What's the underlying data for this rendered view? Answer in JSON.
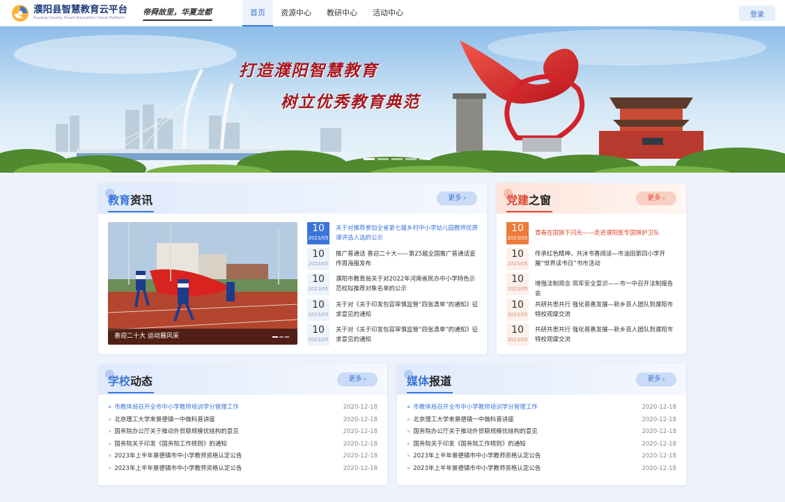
{
  "header": {
    "title": "濮阳县智慧教育云平台",
    "subtitle": "Puyang County Smart Education Cloud Platform",
    "slogan": "帝舜故里，华夏龙都",
    "nav": [
      "首页",
      "资源中心",
      "教研中心",
      "活动中心"
    ],
    "login": "登录"
  },
  "banner": {
    "line1": "打造濮阳智慧教育",
    "line2": "树立优秀教育典范"
  },
  "colors": {
    "primary": "#3a74d9",
    "party_red": "#e0452c",
    "orange": "#ee7a3b"
  },
  "news": {
    "title_a": "教育",
    "title_b": "资讯",
    "more": "更多",
    "photo_caption": "喜迎二十大 运动展风采",
    "items": [
      {
        "day": "10",
        "ym": "2023/05",
        "text": "关于对推荐参加全省第七届乡村中小学幼儿园教师优质课评选人选的公示"
      },
      {
        "day": "10",
        "ym": "2023/05",
        "text": "推广普通话 喜迎二十大——第25届全国推广普通话宣传周海报发布"
      },
      {
        "day": "10",
        "ym": "2023/05",
        "text": "濮阳市教育局关于对2022年河南省民办中小学特色示范校拟推荐对象名单的公示"
      },
      {
        "day": "10",
        "ym": "2023/05",
        "text": "关于对《关于印发包容审慎监管“四张清单”的通知》征求意见的通知"
      },
      {
        "day": "10",
        "ym": "2023/05",
        "text": "关于对《关于印发包容审慎监管“四张清单”的通知》征求意见的通知"
      }
    ]
  },
  "party": {
    "title_a": "党建",
    "title_b": "之窗",
    "more": "更多",
    "items": [
      {
        "day": "10",
        "ym": "2023/05",
        "text": "青春在国旗下闪光——走进濮阳医专国旗护卫队"
      },
      {
        "day": "10",
        "ym": "2023/05",
        "text": "传承红色精神，共沐书香阅读—市油田第四小学开展“世界读书日”书市活动"
      },
      {
        "day": "10",
        "ym": "2023/05",
        "text": "增强法制观念 筑牢安全意识——市一中召开法制报告会"
      },
      {
        "day": "10",
        "ym": "2023/05",
        "text": "共研共思共行 强化普惠发展—新乡百人团队到濮阳市特校观摩交流"
      },
      {
        "day": "10",
        "ym": "2023/05",
        "text": "共研共思共行 强化普惠发展—新乡百人团队到濮阳市特校观摩交流"
      }
    ]
  },
  "school": {
    "title_a": "学校",
    "title_b": "动态",
    "more": "更多",
    "rows": [
      {
        "text": "市教体局召开全市中小学教师培训学分管理工作",
        "date": "2020-12-18"
      },
      {
        "text": "北京理工大学来景德镇一中做科普讲座",
        "date": "2020-12-18"
      },
      {
        "text": "国务院办公厅关于推动外贸稳规模优结构的意见",
        "date": "2020-12-18"
      },
      {
        "text": "国务院关于印发《国务院工作规则》的通知",
        "date": "2020-12-18"
      },
      {
        "text": "2023年上半年景德镇市中小学教师资格认定公告",
        "date": "2020-12-18"
      },
      {
        "text": "2023年上半年景德镇市中小学教师资格认定公告",
        "date": "2020-12-18"
      }
    ]
  },
  "media": {
    "title_a": "媒体",
    "title_b": "报道",
    "more": "更多",
    "rows": [
      {
        "text": "市教体局召开全市中小学教师培训学分管理工作",
        "date": "2020-12-18"
      },
      {
        "text": "北京理工大学来景德镇一中做科普讲座",
        "date": "2020-12-18"
      },
      {
        "text": "国务院办公厅关于推动外贸稳规模优结构的意见",
        "date": "2020-12-18"
      },
      {
        "text": "国务院关于印发《国务院工作规则》的通知",
        "date": "2020-12-18"
      },
      {
        "text": "2023年上半年景德镇市中小学教师资格认定公告",
        "date": "2020-12-18"
      },
      {
        "text": "2023年上半年景德镇市中小学教师资格认定公告",
        "date": "2020-12-18"
      }
    ]
  }
}
